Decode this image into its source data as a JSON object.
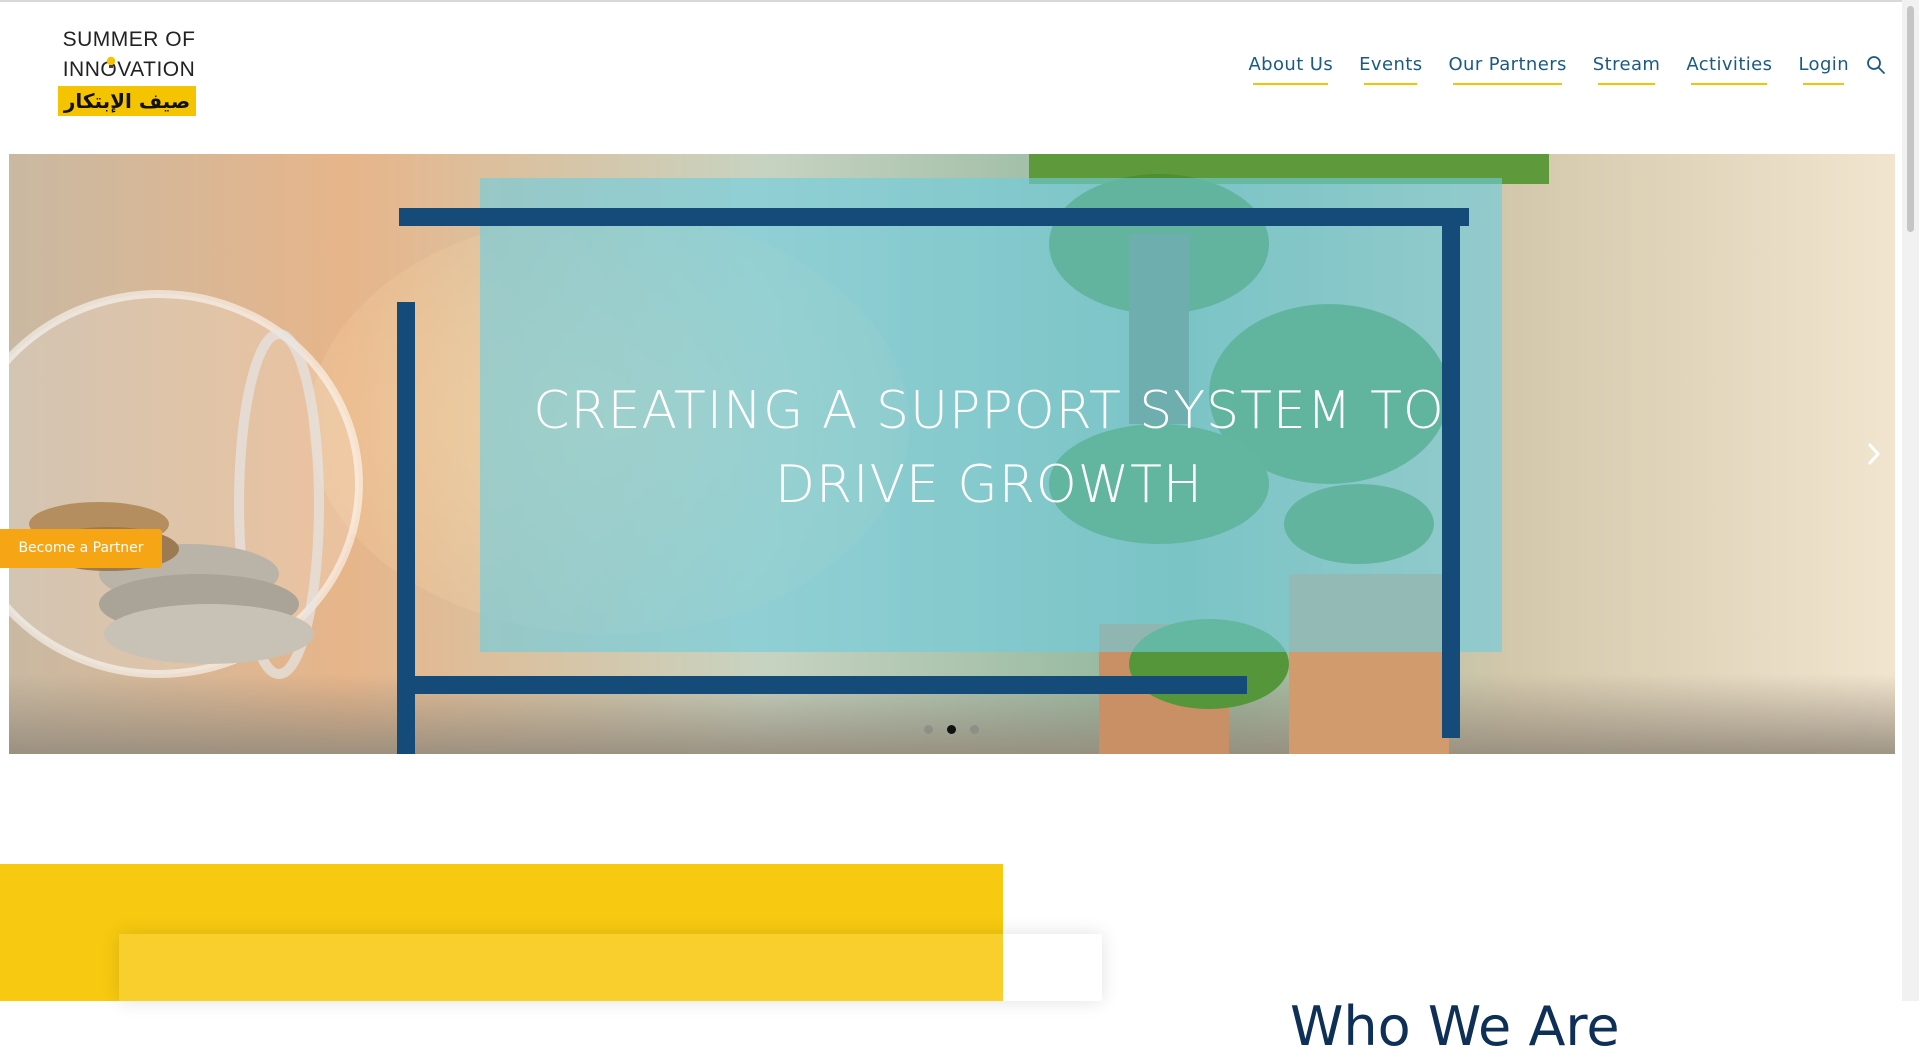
{
  "logo": {
    "line1": "SUMMER OF",
    "line2": "INNOVATION",
    "arabic": "صيف الإبتكار"
  },
  "nav": {
    "items": [
      "About Us",
      "Events",
      "Our Partners",
      "Stream",
      "Activities",
      "Login"
    ]
  },
  "hero": {
    "title": "CREATING A SUPPORT SYSTEM TO DRIVE GROWTH",
    "slides": 3,
    "active_slide": 2
  },
  "partner_button": {
    "label": "Become a Partner"
  },
  "section": {
    "heading": "Who We Are"
  },
  "colors": {
    "accent_yellow": "#f7c910",
    "nav_blue": "#1a5a84",
    "frame_blue": "#144b78",
    "button_orange": "#f6a514"
  }
}
